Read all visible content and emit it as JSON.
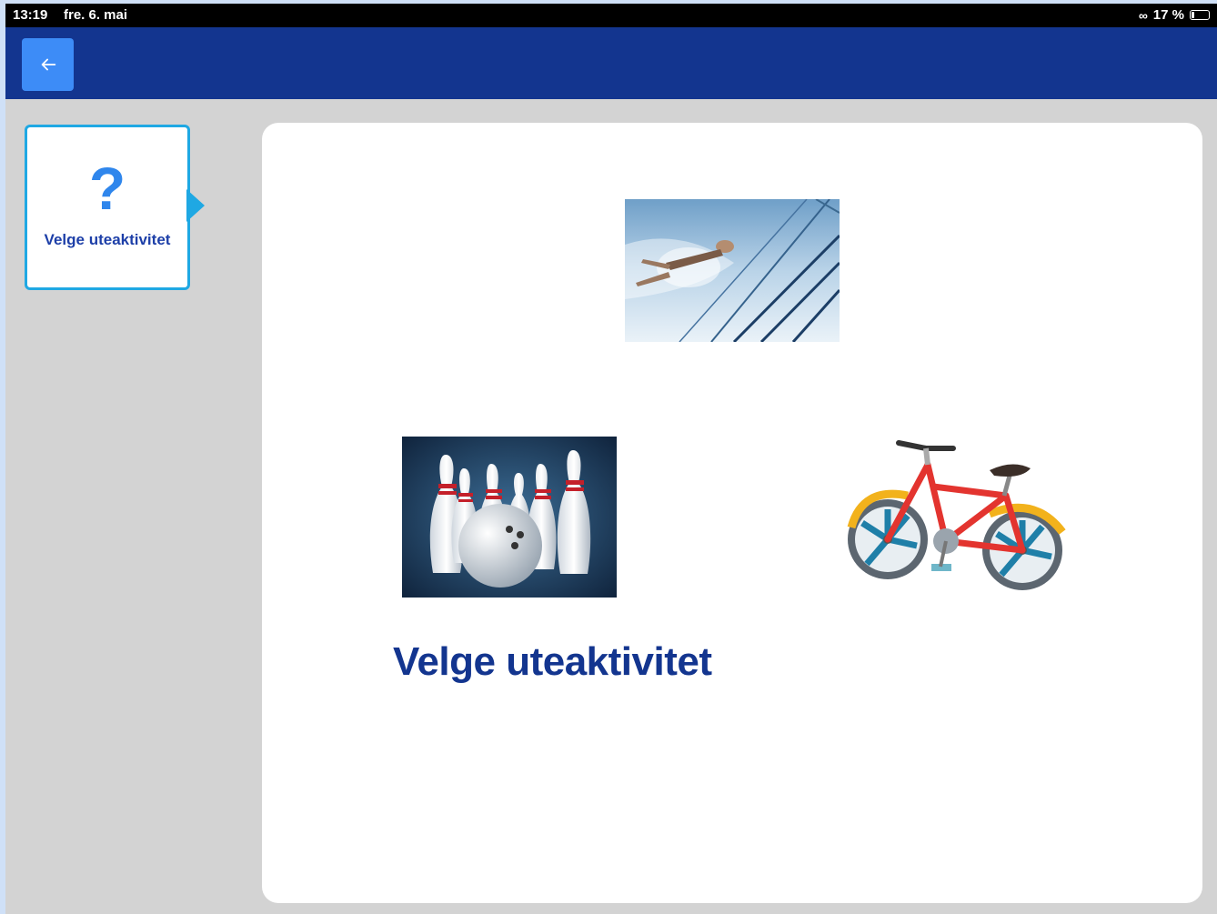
{
  "status_bar": {
    "time": "13:19",
    "date": "fre. 6. mai",
    "battery_percent": "17 %"
  },
  "app_bar": {
    "back_icon": "arrow-left-icon",
    "accent": "#13358f"
  },
  "sidebar_card": {
    "icon": "question-mark",
    "symbol": "?",
    "label": "Velge uteaktivitet"
  },
  "main": {
    "title": "Velge uteaktivitet",
    "choices": [
      {
        "icon": "swimming-picture"
      },
      {
        "icon": "bowling-picture"
      },
      {
        "icon": "bicycle-picture"
      }
    ]
  }
}
